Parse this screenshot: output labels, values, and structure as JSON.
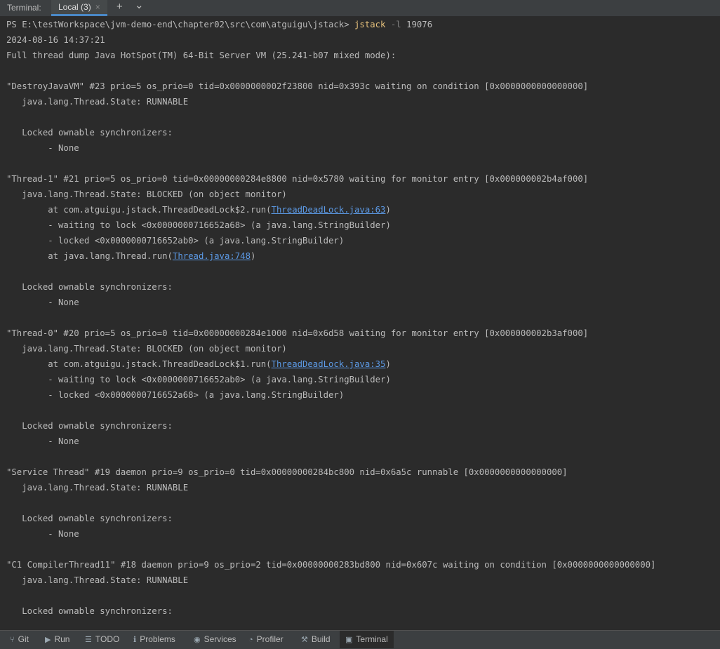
{
  "tabbar": {
    "label": "Terminal:",
    "active_tab": "Local (3)",
    "close_icon": "×",
    "add_icon": "+",
    "dropdown_icon": "⌄"
  },
  "console": {
    "prompt": "PS E:\\testWorkspace\\jvm-demo-end\\chapter02\\src\\com\\atguigu\\jstack> ",
    "command": "jstack",
    "flag": " -l ",
    "pid": "19076",
    "timestamp": "2024-08-16 14:37:21",
    "header": "Full thread dump Java HotSpot(TM) 64-Bit Server VM (25.241-b07 mixed mode):",
    "lines": {
      "l5": "\"DestroyJavaVM\" #23 prio=5 os_prio=0 tid=0x0000000002f23800 nid=0x393c waiting on condition [0x0000000000000000]",
      "l6": "   java.lang.Thread.State: RUNNABLE",
      "l8": "   Locked ownable synchronizers:",
      "l9": "        - None",
      "l11": "\"Thread-1\" #21 prio=5 os_prio=0 tid=0x00000000284e8800 nid=0x5780 waiting for monitor entry [0x000000002b4af000]",
      "l12": "   java.lang.Thread.State: BLOCKED (on object monitor)",
      "l13a": "        at com.atguigu.jstack.ThreadDeadLock$2.run(",
      "l13link": "ThreadDeadLock.java:63",
      "l13b": ")",
      "l14": "        - waiting to lock <0x0000000716652a68> (a java.lang.StringBuilder)",
      "l15": "        - locked <0x0000000716652ab0> (a java.lang.StringBuilder)",
      "l16a": "        at java.lang.Thread.run(",
      "l16link": "Thread.java:748",
      "l16b": ")",
      "l18": "   Locked ownable synchronizers:",
      "l19": "        - None",
      "l21": "\"Thread-0\" #20 prio=5 os_prio=0 tid=0x00000000284e1000 nid=0x6d58 waiting for monitor entry [0x000000002b3af000]",
      "l22": "   java.lang.Thread.State: BLOCKED (on object monitor)",
      "l23a": "        at com.atguigu.jstack.ThreadDeadLock$1.run(",
      "l23link": "ThreadDeadLock.java:35",
      "l23b": ")",
      "l24": "        - waiting to lock <0x0000000716652ab0> (a java.lang.StringBuilder)",
      "l25": "        - locked <0x0000000716652a68> (a java.lang.StringBuilder)",
      "l27": "   Locked ownable synchronizers:",
      "l28": "        - None",
      "l30": "\"Service Thread\" #19 daemon prio=9 os_prio=0 tid=0x00000000284bc800 nid=0x6a5c runnable [0x0000000000000000]",
      "l31": "   java.lang.Thread.State: RUNNABLE",
      "l33": "   Locked ownable synchronizers:",
      "l34": "        - None",
      "l36": "\"C1 CompilerThread11\" #18 daemon prio=9 os_prio=2 tid=0x00000000283bd800 nid=0x607c waiting on condition [0x0000000000000000]",
      "l37": "   java.lang.Thread.State: RUNNABLE",
      "l39": "   Locked ownable synchronizers:"
    }
  },
  "statusbar": {
    "items": [
      {
        "label": "Git",
        "icon": "git-icon"
      },
      {
        "label": "Run",
        "icon": "run-icon"
      },
      {
        "label": "TODO",
        "icon": "todo-icon"
      },
      {
        "label": "Problems",
        "icon": "problems-icon"
      },
      {
        "label": "Services",
        "icon": "services-icon"
      },
      {
        "label": "Profiler",
        "icon": "profiler-icon"
      },
      {
        "label": "Build",
        "icon": "build-icon"
      },
      {
        "label": "Terminal",
        "icon": "terminal-icon"
      }
    ]
  },
  "colors": {
    "background": "#2b2b2b",
    "text": "#bbbbbb",
    "command": "#e5c07b",
    "link": "#5c9ae6",
    "tab_accent": "#4a88c7"
  }
}
